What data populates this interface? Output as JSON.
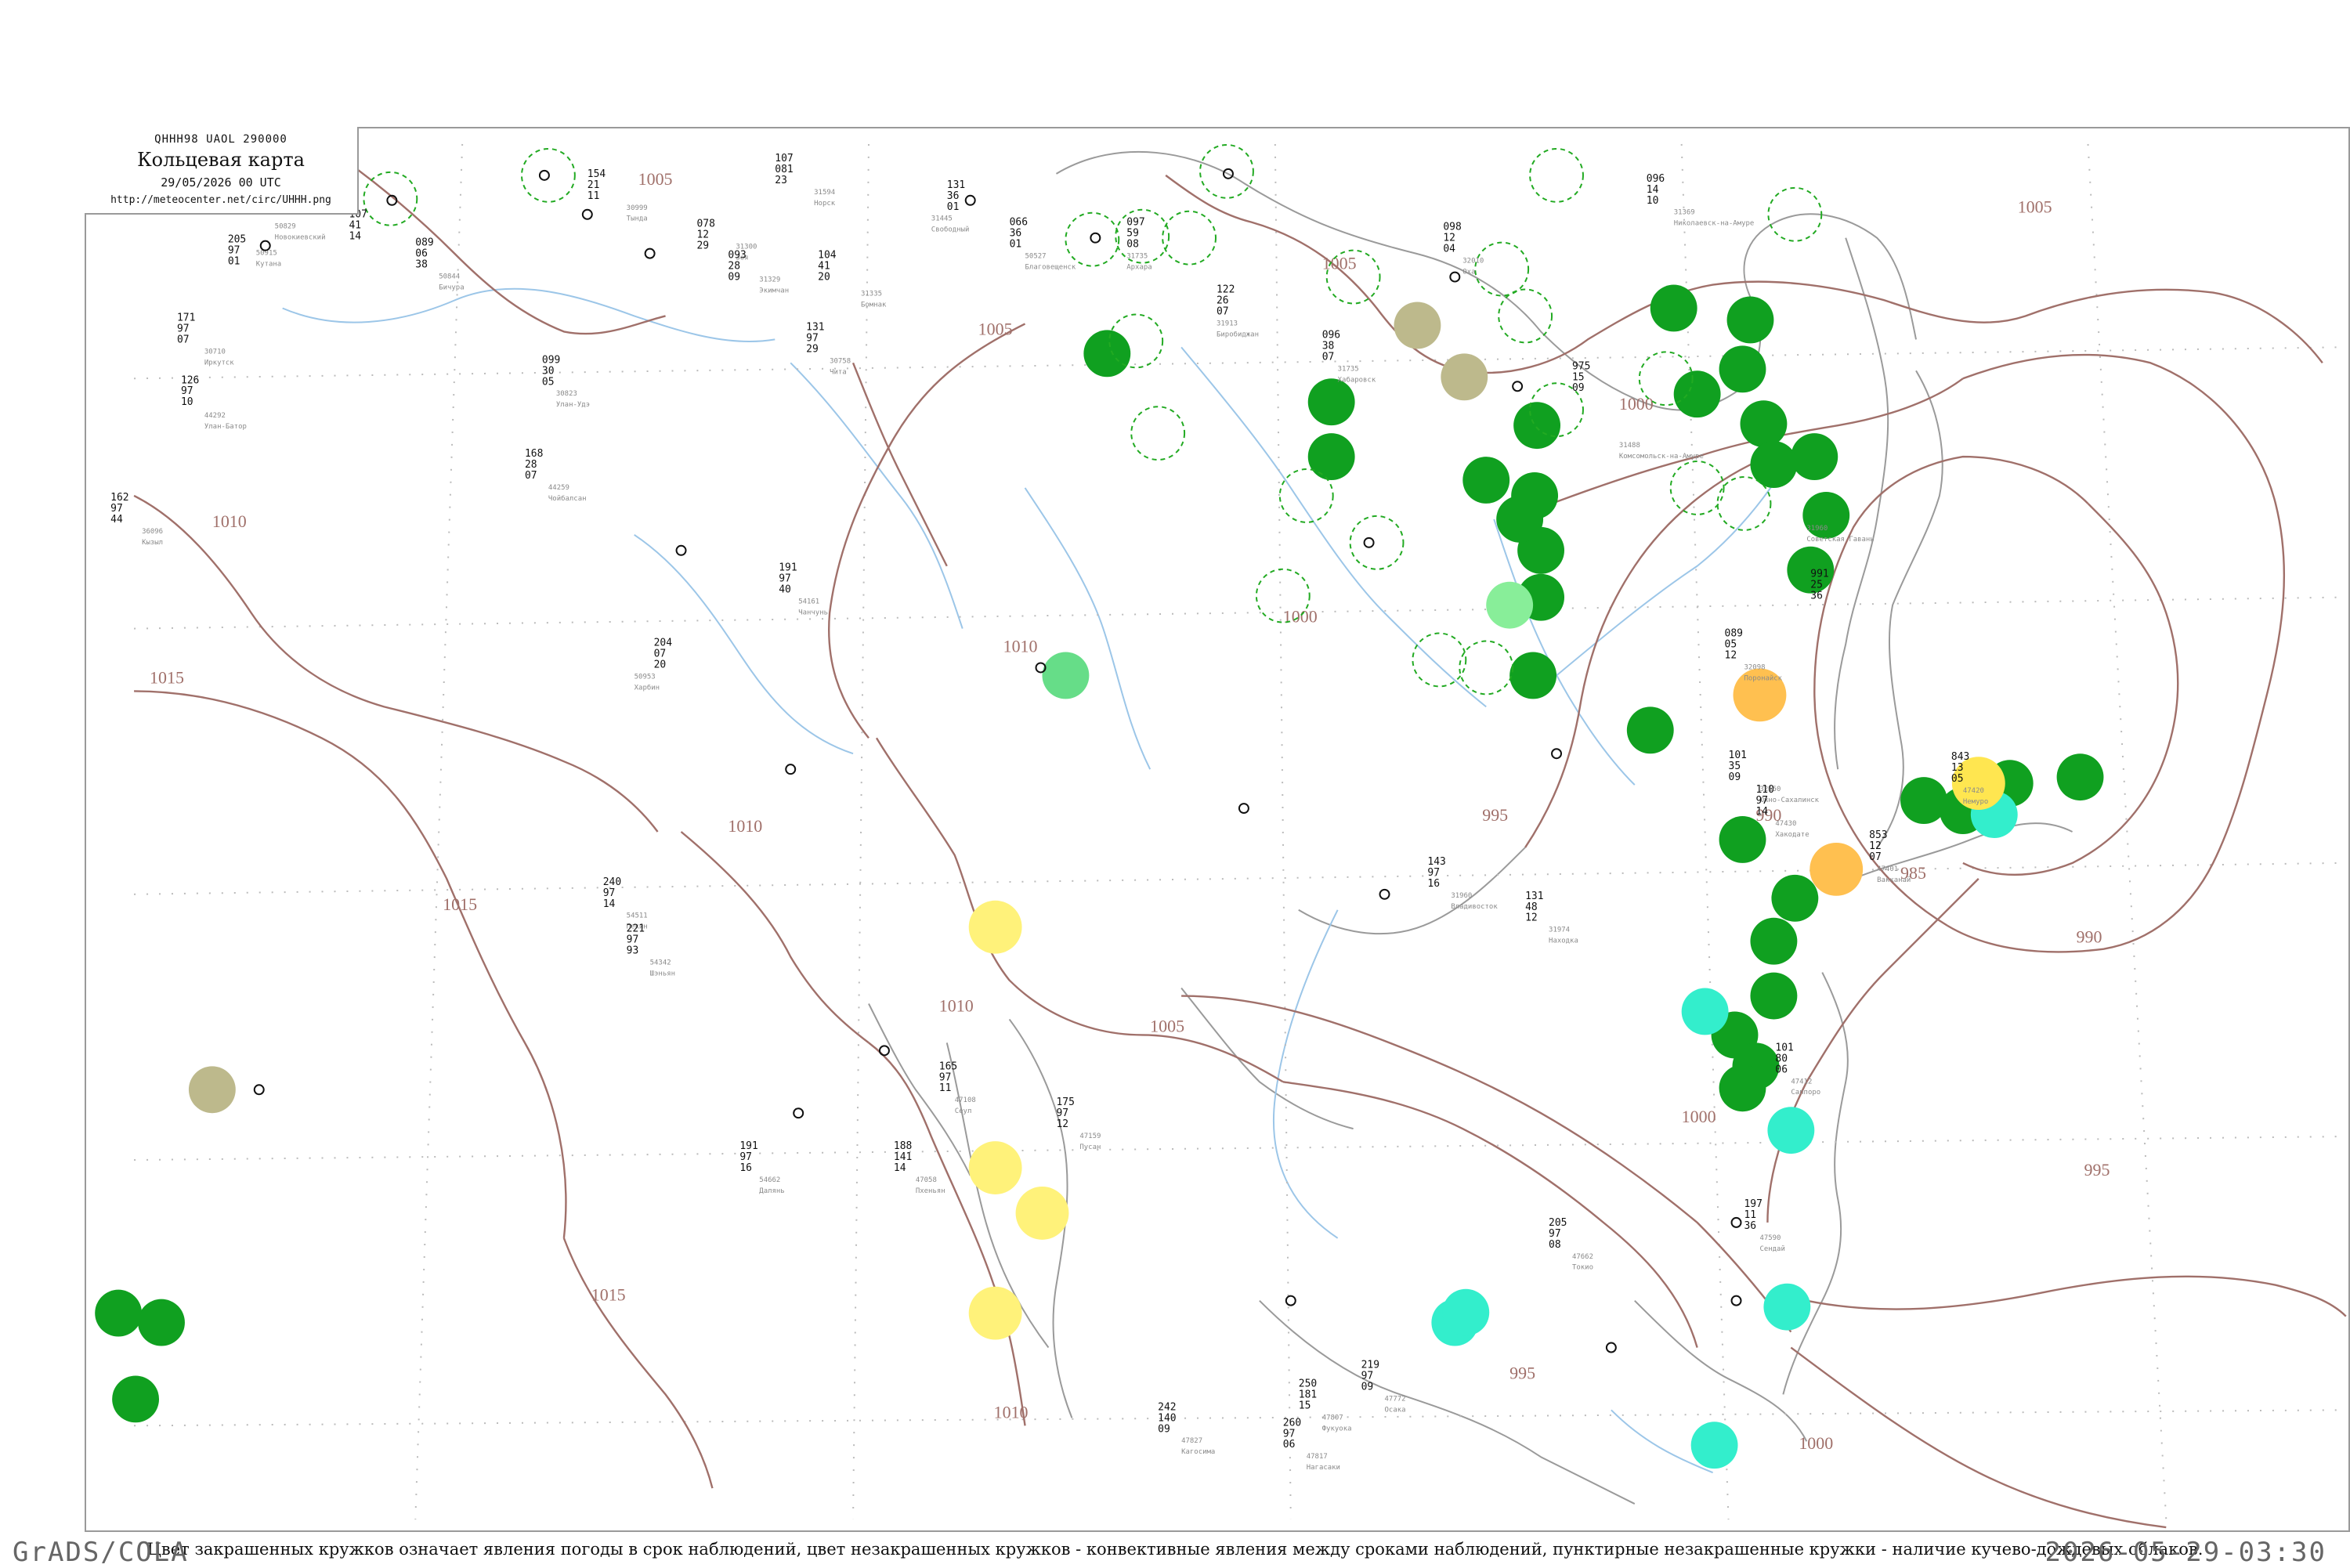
{
  "header": {
    "code": "QHHH98 UAOL 290000",
    "title": "Кольцевая карта",
    "date": "29/05/2026 00 UTC",
    "url": "http://meteocenter.net/circ/UHHH.png"
  },
  "caption": "Цвет закрашенных кружков означает явления погоды в срок наблюдений, цвет незакрашенных кружков - конвективные явления между сроками наблюдений, пунктирные незакрашенные кружки - наличие кучево-дождевых облаков.",
  "footer": {
    "left": "GrADS/COLA",
    "right": "2026-05-29-03:30"
  },
  "colors": {
    "isobar": "#a0706a",
    "river": "#9cc6e8",
    "station_code": "#8a8a8a",
    "rain_green": "#10a020",
    "shower_green": "#66dd88",
    "drizzle_cyan": "#33eecc",
    "haze_yellow": "#fff27a",
    "fog_olive": "#bdb98c",
    "thunder_orange": "#ffc050",
    "cb_dashed": "#22aa22"
  },
  "isobar_labels": [
    "1005",
    "1005",
    "1005",
    "1005",
    "1000",
    "1000",
    "1010",
    "1010",
    "1015",
    "1015",
    "1010",
    "1010",
    "1005",
    "995",
    "990",
    "985",
    "990",
    "995",
    "1000",
    "1015",
    "1010",
    "1000",
    "995"
  ],
  "stations": [
    {
      "name": "Кутана",
      "code": "50915",
      "t": "205",
      "p": "97",
      "b": "01",
      "c": "0"
    },
    {
      "name": "Новокиевский",
      "code": "50829",
      "t": "107",
      "p": "41",
      "b": "14",
      "c": "0"
    },
    {
      "name": "Бичура",
      "code": "50844",
      "t": "089",
      "p": "06",
      "b": "38",
      "c": "0"
    },
    {
      "name": "Тында",
      "code": "30999",
      "t": "154",
      "p": "21",
      "b": "11",
      "c": "0"
    },
    {
      "name": "Зея",
      "code": "31300",
      "t": "078",
      "p": "12",
      "b": "29",
      "c": "0"
    },
    {
      "name": "Норск",
      "code": "31594",
      "t": "107",
      "p": "081",
      "b": "23",
      "c": "0"
    },
    {
      "name": "Экимчан",
      "code": "31329",
      "t": "093",
      "p": "28",
      "b": "09",
      "c": "0"
    },
    {
      "name": "Бомнак",
      "code": "31335",
      "t": "104",
      "p": "41",
      "b": "20",
      "c": "0"
    },
    {
      "name": "Свободный",
      "code": "31445",
      "t": "131",
      "p": "36",
      "b": "01",
      "c": "0"
    },
    {
      "name": "Благовещенск",
      "code": "50527",
      "t": "066",
      "p": "36",
      "b": "01",
      "c": "0"
    },
    {
      "name": "Архара",
      "code": "31735",
      "t": "097",
      "p": "59",
      "b": "08",
      "c": "0"
    },
    {
      "name": "Биробиджан",
      "code": "31913",
      "t": "122",
      "p": "26",
      "b": "07",
      "c": "0"
    },
    {
      "name": "Хабаровск",
      "code": "31735",
      "t": "096",
      "p": "38",
      "b": "07",
      "c": "0"
    },
    {
      "name": "Николаевск-на-Амуре",
      "code": "31369",
      "t": "096",
      "p": "14",
      "b": "10",
      "c": "0"
    },
    {
      "name": "Комсомольск-на-Амуре",
      "code": "31488",
      "t": "975",
      "p": "15",
      "b": "09",
      "c": "0"
    },
    {
      "name": "Советская Гавань",
      "code": "31960",
      "t": "991",
      "p": "25",
      "b": "36",
      "c": "0"
    },
    {
      "name": "Владивосток",
      "code": "31960",
      "t": "143",
      "p": "97",
      "b": "16",
      "c": "0"
    },
    {
      "name": "Находка",
      "code": "31974",
      "t": "131",
      "p": "48",
      "b": "12",
      "c": "0"
    },
    {
      "name": "Южно-Сахалинск",
      "code": "32150",
      "t": "101",
      "p": "35",
      "b": "09",
      "c": "0"
    },
    {
      "name": "Оха",
      "code": "32010",
      "t": "098",
      "p": "12",
      "b": "04",
      "c": "0"
    },
    {
      "name": "Поронайск",
      "code": "32098",
      "t": "089",
      "p": "05",
      "b": "12",
      "c": "0"
    },
    {
      "name": "Хакодате",
      "code": "47430",
      "t": "110",
      "p": "97",
      "b": "14",
      "c": "0"
    },
    {
      "name": "Саппоро",
      "code": "47412",
      "t": "101",
      "p": "80",
      "b": "06",
      "c": "0"
    },
    {
      "name": "Вакканай",
      "code": "47401",
      "t": "853",
      "p": "12",
      "b": "07",
      "c": "0"
    },
    {
      "name": "Немуро",
      "code": "47420",
      "t": "843",
      "p": "13",
      "b": "05",
      "c": "0"
    },
    {
      "name": "Токио",
      "code": "47662",
      "t": "205",
      "p": "97",
      "b": "08",
      "c": "0"
    },
    {
      "name": "Сендай",
      "code": "47590",
      "t": "197",
      "p": "11",
      "b": "36",
      "c": "0"
    },
    {
      "name": "Осака",
      "code": "47772",
      "t": "219",
      "p": "97",
      "b": "09",
      "c": "0"
    },
    {
      "name": "Фукуока",
      "code": "47807",
      "t": "250",
      "p": "181",
      "b": "15",
      "c": "0"
    },
    {
      "name": "Нагасаки",
      "code": "47817",
      "t": "260",
      "p": "97",
      "b": "06",
      "c": "0"
    },
    {
      "name": "Кагосима",
      "code": "47827",
      "t": "242",
      "p": "140",
      "b": "09",
      "c": "0"
    },
    {
      "name": "Сеул",
      "code": "47108",
      "t": "165",
      "p": "97",
      "b": "11",
      "c": "0"
    },
    {
      "name": "Пусан",
      "code": "47159",
      "t": "175",
      "p": "97",
      "b": "12",
      "c": "0"
    },
    {
      "name": "Пхеньян",
      "code": "47058",
      "t": "188",
      "p": "141",
      "b": "14",
      "c": "0"
    },
    {
      "name": "Далянь",
      "code": "54662",
      "t": "191",
      "p": "97",
      "b": "16",
      "c": "0"
    },
    {
      "name": "Пекин",
      "code": "54511",
      "t": "240",
      "p": "97",
      "b": "14",
      "c": "0"
    },
    {
      "name": "Шэньян",
      "code": "54342",
      "t": "221",
      "p": "97",
      "b": "93",
      "c": "0"
    },
    {
      "name": "Харбин",
      "code": "50953",
      "t": "204",
      "p": "07",
      "b": "20",
      "c": "0"
    },
    {
      "name": "Чанчунь",
      "code": "54161",
      "t": "191",
      "p": "97",
      "b": "40",
      "c": "0"
    },
    {
      "name": "Улан-Батор",
      "code": "44292",
      "t": "126",
      "p": "97",
      "b": "10",
      "c": "0"
    },
    {
      "name": "Чойбалсан",
      "code": "44259",
      "t": "168",
      "p": "28",
      "b": "07",
      "c": "0"
    },
    {
      "name": "Кызыл",
      "code": "36096",
      "t": "162",
      "p": "97",
      "b": "44",
      "c": "0"
    },
    {
      "name": "Иркутск",
      "code": "30710",
      "t": "171",
      "p": "97",
      "b": "07",
      "c": "0"
    },
    {
      "name": "Чита",
      "code": "30758",
      "t": "131",
      "p": "97",
      "b": "29",
      "c": "0"
    },
    {
      "name": "Улан-Удэ",
      "code": "30823",
      "t": "099",
      "p": "30",
      "b": "05",
      "c": "0"
    }
  ]
}
